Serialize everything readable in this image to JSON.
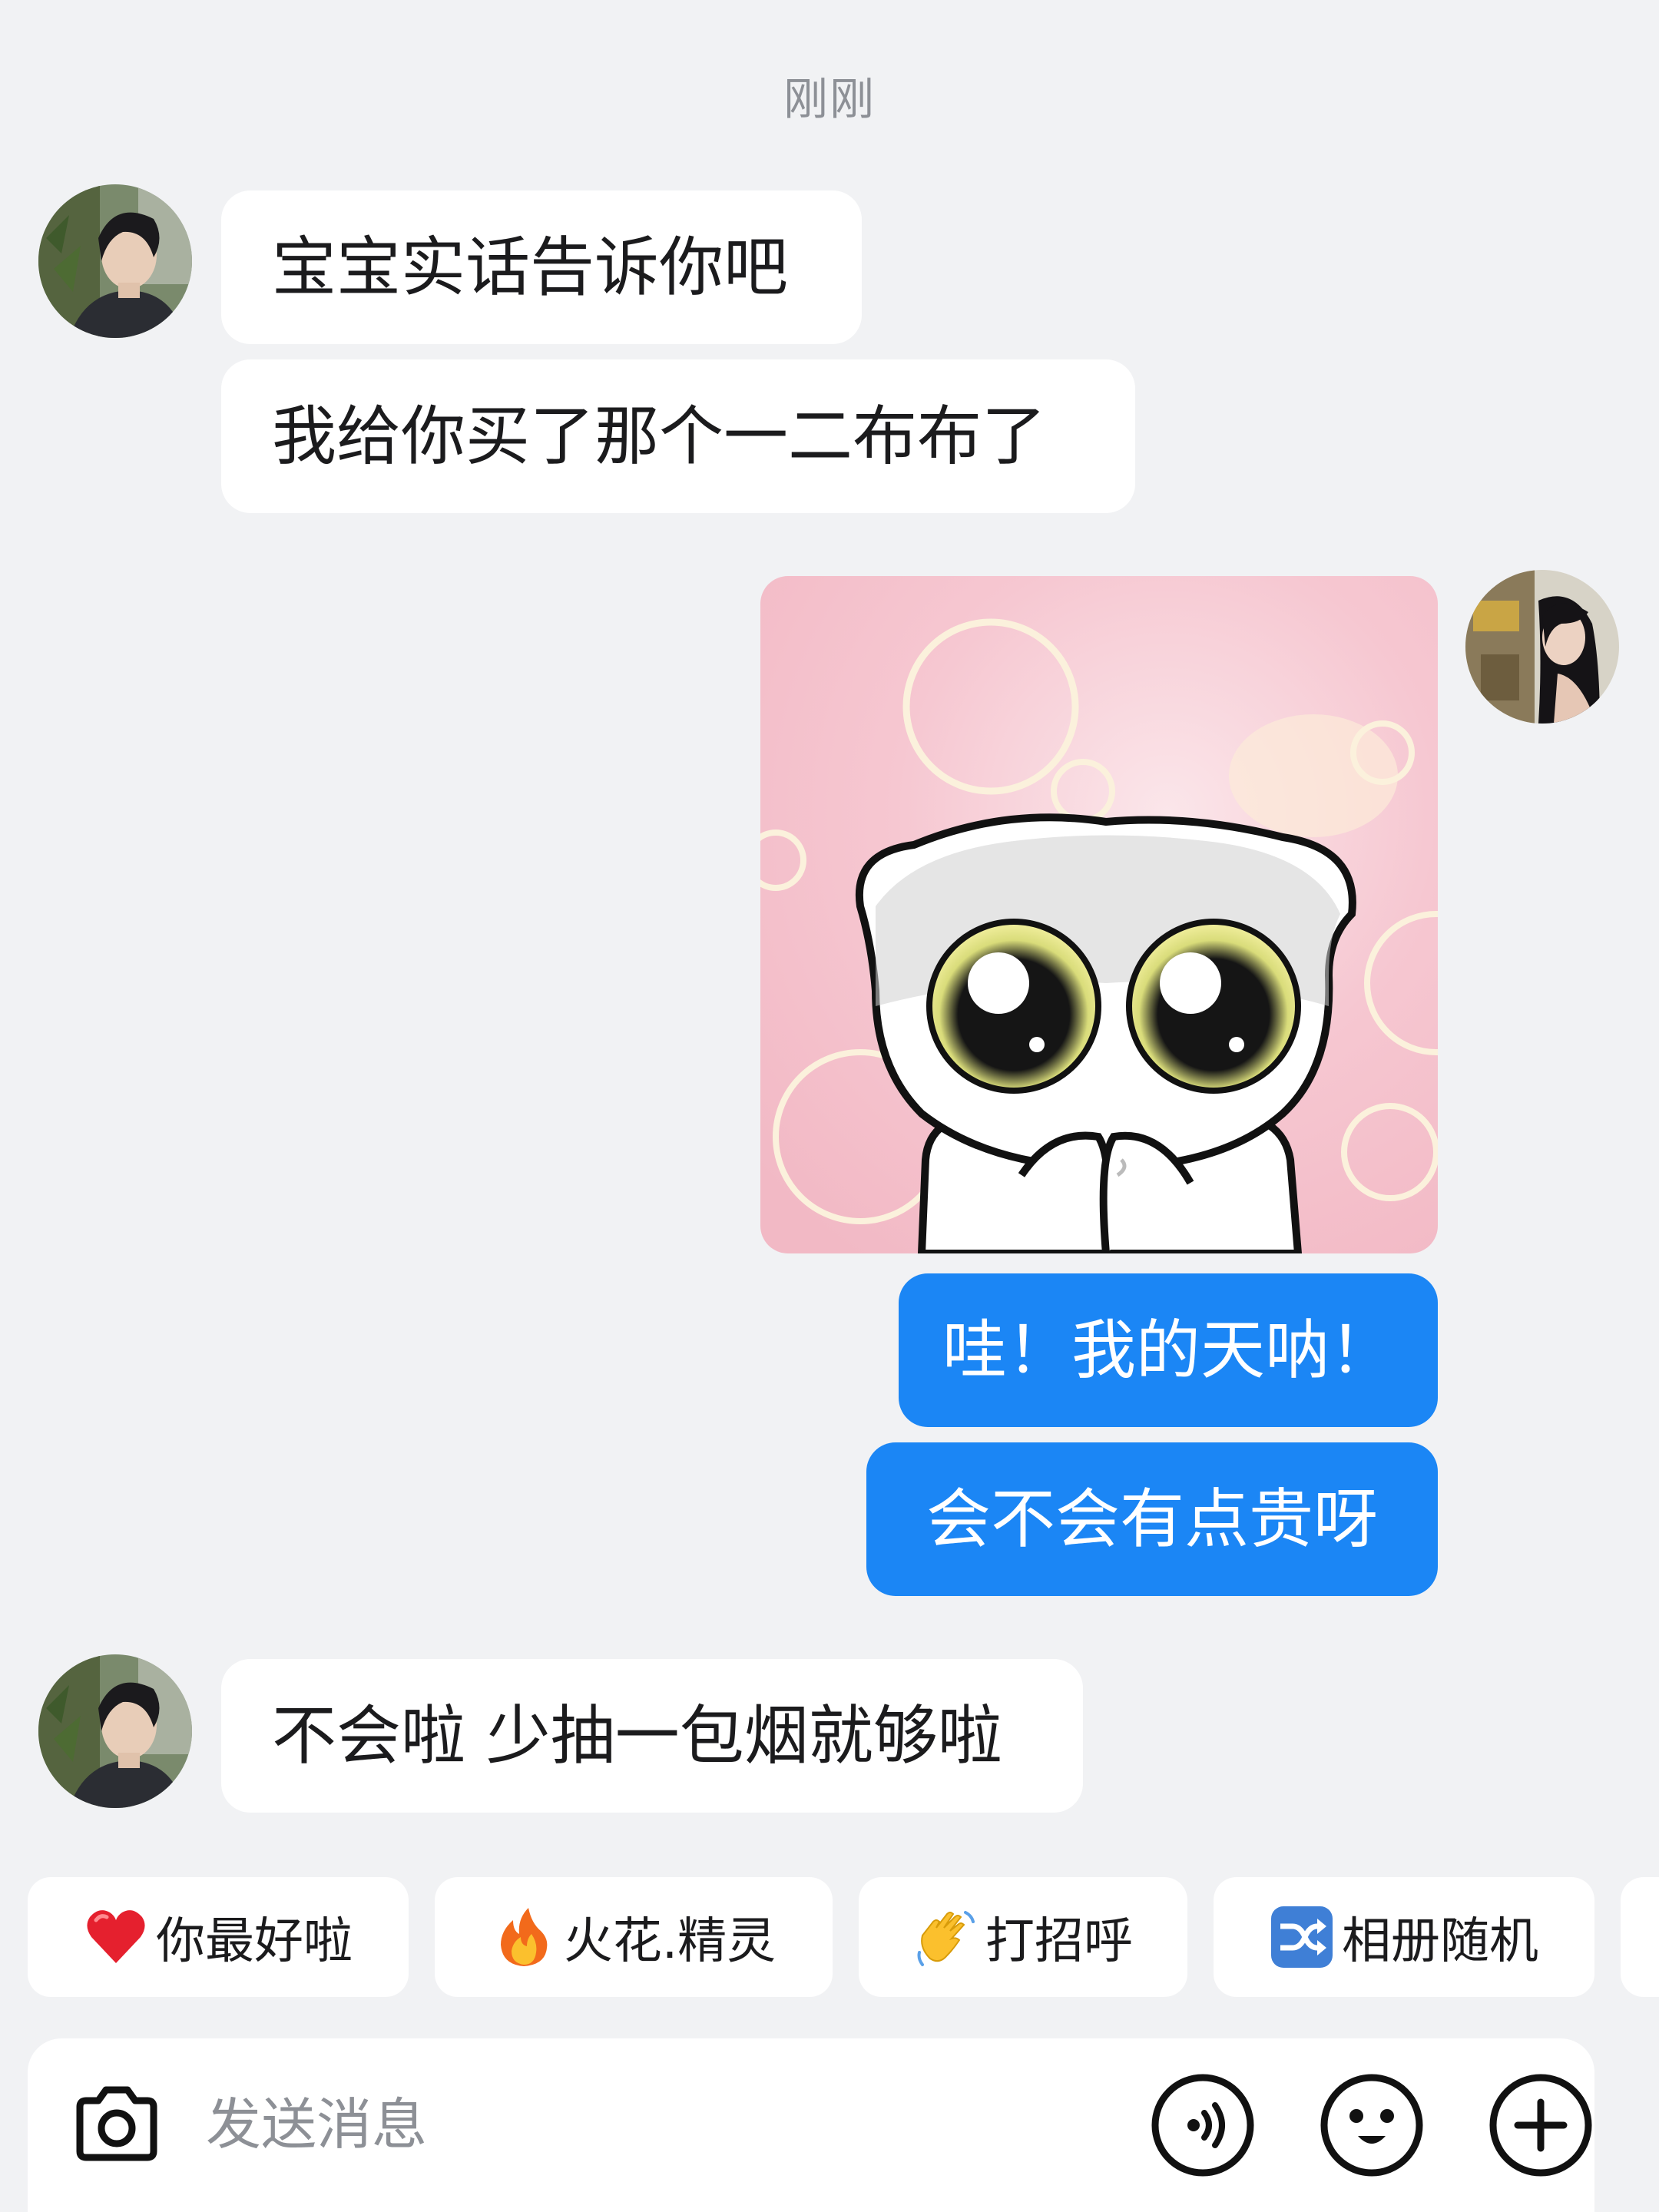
{
  "timestamp": "刚刚",
  "messages": [
    {
      "sender": "other",
      "text": "宝宝实话告诉你吧"
    },
    {
      "sender": "other",
      "text": "我给你买了那个一二布布了"
    },
    {
      "sender": "self",
      "type": "sticker"
    },
    {
      "sender": "self",
      "text": "哇！我的天呐！"
    },
    {
      "sender": "self",
      "text": "会不会有点贵呀"
    },
    {
      "sender": "other",
      "text": "不会啦 少抽一包烟就够啦"
    }
  ],
  "quick_replies": [
    {
      "emoji": "red-heart",
      "label": "你最好啦"
    },
    {
      "emoji": "fire",
      "label": "火花.精灵"
    },
    {
      "emoji": "waving-hand",
      "label": "打招呼"
    },
    {
      "emoji": "shuffle",
      "label": "相册随机"
    }
  ],
  "input": {
    "placeholder": "发送消息"
  },
  "colors": {
    "background": "#f1f2f4",
    "incoming_bubble": "#ffffff",
    "outgoing_bubble": "#1b86f5"
  }
}
